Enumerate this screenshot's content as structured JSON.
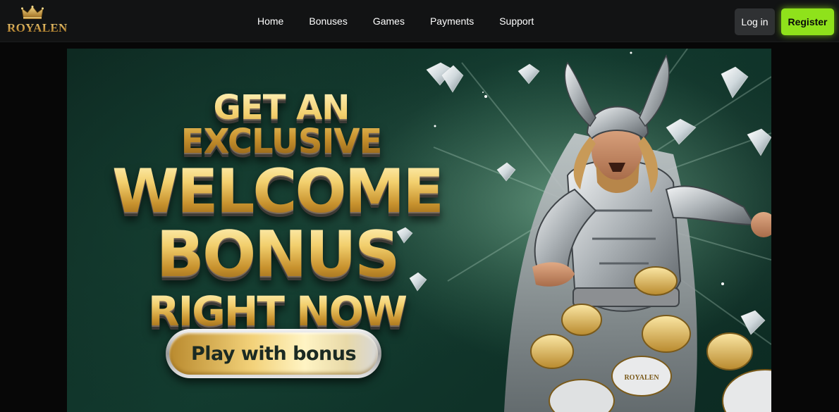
{
  "brand": {
    "name": "ROYALEN",
    "logo_icon": "crown-icon"
  },
  "nav": {
    "items": [
      {
        "label": "Home"
      },
      {
        "label": "Bonuses"
      },
      {
        "label": "Games"
      },
      {
        "label": "Payments"
      },
      {
        "label": "Support"
      }
    ]
  },
  "auth": {
    "login_label": "Log in",
    "register_label": "Register"
  },
  "banner": {
    "headline": {
      "line1": "GET AN EXCLUSIVE",
      "line2": "WELCOME",
      "line3": "BONUS",
      "line4": "RIGHT NOW"
    },
    "cta_label": "Play with bonus",
    "hero_image": "armored-warrior-with-casino-chips-illustration",
    "chip_logo_text": "ROYALEN"
  },
  "colors": {
    "header_bg": "#121314",
    "page_bg": "#070707",
    "register_accent": "#8fe21b",
    "login_bg": "#2f3133",
    "banner_bg": "#123a2e",
    "gold": "#e6bf58"
  }
}
